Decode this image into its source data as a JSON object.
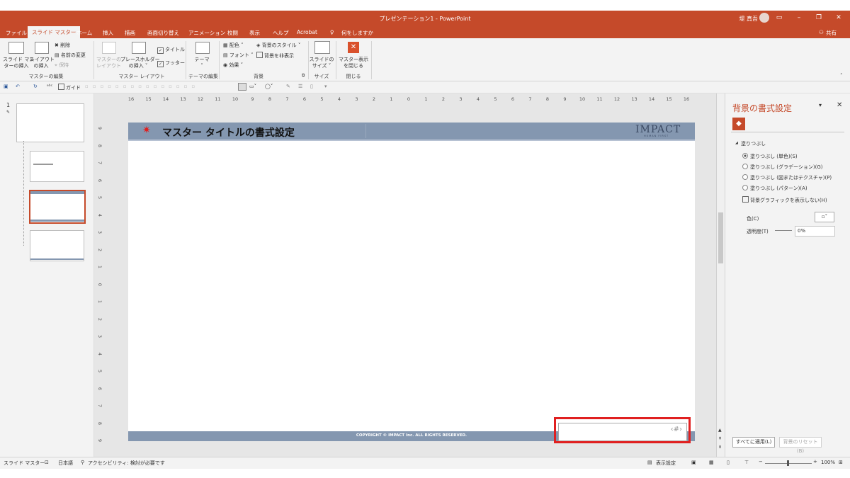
{
  "window": {
    "title": "プレゼンテーション1  -  PowerPoint",
    "user": "堤 真吾",
    "share": "共有"
  },
  "tabs": [
    "ファイル",
    "スライド マスター",
    "ホーム",
    "挿入",
    "描画",
    "画面切り替え",
    "アニメーション",
    "校閲",
    "表示",
    "ヘルプ",
    "Acrobat",
    "何をしますか"
  ],
  "ribbon": {
    "insert_master": "スライド マス\nターの挿入",
    "insert_layout": "レイアウト\nの挿入",
    "delete": "削除",
    "rename": "名前の変更",
    "preserve": "保持",
    "group_edit": "マスターの編集",
    "master_layout": "マスターの\nレイアウト",
    "insert_placeholder": "プレースホルダー\nの挿入 ˅",
    "title_chk": "タイトル",
    "footer_chk": "フッター",
    "group_layout": "マスター レイアウト",
    "themes": "テーマ",
    "group_theme": "テーマの編集",
    "colors": "配色 ˅",
    "fonts": "フォント ˅",
    "effects": "効果 ˅",
    "bg_styles": "背景のスタイル ˅",
    "hide_bg": "背景を非表示",
    "group_bg": "背景",
    "slide_size": "スライドの\nサイズ ˅",
    "group_size": "サイズ",
    "close_master": "マスター表示\nを閉じる",
    "group_close": "閉じる"
  },
  "qat": {
    "guide": "ガイド"
  },
  "thumbs": {
    "number": "1"
  },
  "ruler_h": [
    "16",
    "15",
    "14",
    "13",
    "12",
    "11",
    "10",
    "9",
    "8",
    "7",
    "6",
    "5",
    "4",
    "3",
    "2",
    "1",
    "0",
    "1",
    "2",
    "3",
    "4",
    "5",
    "6",
    "7",
    "8",
    "9",
    "10",
    "11",
    "12",
    "13",
    "14",
    "15",
    "16"
  ],
  "ruler_v": [
    "9",
    "8",
    "7",
    "6",
    "5",
    "4",
    "3",
    "2",
    "1",
    "0",
    "1",
    "2",
    "3",
    "4",
    "5",
    "6",
    "7",
    "8",
    "9"
  ],
  "slide": {
    "title": "マスター タイトルの書式設定",
    "logo": "IMPACT",
    "logo_sub": "HUMAN FIRST",
    "footer": "COPYRIGHT © IMPACT Inc. ALL RIGHTS RESERVED.",
    "page_num": "‹#›"
  },
  "pane": {
    "title": "背景の書式設定",
    "section": "塗りつぶし",
    "options": [
      "塗りつぶし (単色)(S)",
      "塗りつぶし (グラデーション)(G)",
      "塗りつぶし (図またはテクスチャ)(P)",
      "塗りつぶし (パターン)(A)"
    ],
    "selected_index": 0,
    "hide_graphics": "背景グラフィックを表示しない(H)",
    "color_label": "色(C)",
    "transparency_label": "透明度(T)",
    "transparency_value": "0%",
    "apply_all": "すべてに適用(L)",
    "reset": "背景のリセット(B)"
  },
  "status": {
    "view": "スライド マスター",
    "lang": "日本語",
    "accessibility": "アクセシビリティ: 検討が必要です",
    "display_settings": "表示設定",
    "zoom": "100%"
  },
  "colors": {
    "accent": "#c54a2a",
    "slide_bar": "#8497b0",
    "highlight": "#e02020"
  }
}
